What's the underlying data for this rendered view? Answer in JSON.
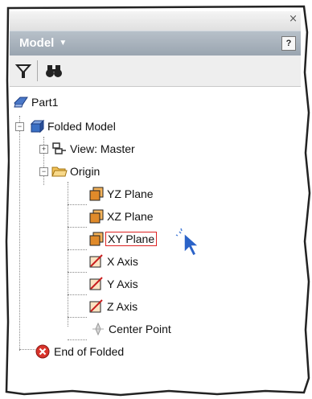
{
  "window": {
    "close_glyph": "×"
  },
  "panel": {
    "title": "Model",
    "title_arrow": "▼",
    "help_label": "?"
  },
  "toolbar": {
    "filter_icon": "filter-icon",
    "find_icon": "binoculars-icon"
  },
  "tree": {
    "root": "Part1",
    "folded_model": "Folded Model",
    "view": "View: Master",
    "origin": "Origin",
    "yz_plane": "YZ Plane",
    "xz_plane": "XZ Plane",
    "xy_plane": "XY Plane",
    "x_axis": "X Axis",
    "y_axis": "Y Axis",
    "z_axis": "Z Axis",
    "center_point": "Center Point",
    "end_of_folded": "End of Folded"
  },
  "colors": {
    "title_bar": "#9aa5b0",
    "plane_orange": "#e08a2a",
    "highlight_red": "#dd2222",
    "cursor_blue": "#2b63c8"
  }
}
